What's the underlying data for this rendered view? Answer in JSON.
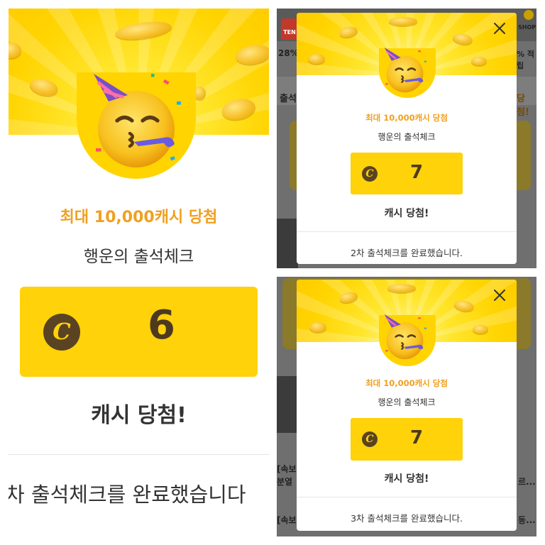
{
  "left_panel": {
    "promo_title": "최대 10,000캐시 당첨",
    "subtitle": "행운의 출석체크",
    "cash_symbol": "C",
    "cash_amount": "6",
    "won_text": "캐시 당첨!",
    "completion_text": "차 출석체크를 완료했습니다",
    "icon": "party-face-icon"
  },
  "top_right": {
    "background": {
      "app_badge": "TEN",
      "percent_text": "28%",
      "shop_label": "SHOP",
      "right_text": "% 적립",
      "section_label": "출석",
      "orange_tail": "당첨!"
    },
    "modal": {
      "promo_title": "최대 10,000캐시 당첨",
      "subtitle": "행운의 출석체크",
      "cash_symbol": "C",
      "cash_amount": "7",
      "won_text": "캐시 당첨!",
      "completion_text": "2차 출석체크를 완료했습니다.",
      "close_icon": "close-icon"
    }
  },
  "bottom_right": {
    "background": {
      "news_1_prefix": "[속보",
      "news_1_line2": "분열",
      "news_1_tail": "르...",
      "news_2_prefix": "[속보",
      "news_2_tail": "동..."
    },
    "modal": {
      "promo_title": "최대 10,000캐시 당첨",
      "subtitle": "행운의 출석체크",
      "cash_symbol": "C",
      "cash_amount": "7",
      "won_text": "캐시 당첨!",
      "completion_text": "3차 출석체크를 완료했습니다.",
      "close_icon": "close-icon"
    }
  },
  "colors": {
    "accent_yellow": "#ffd20a",
    "title_orange": "#f0a020",
    "coin_brown": "#5a4322"
  }
}
